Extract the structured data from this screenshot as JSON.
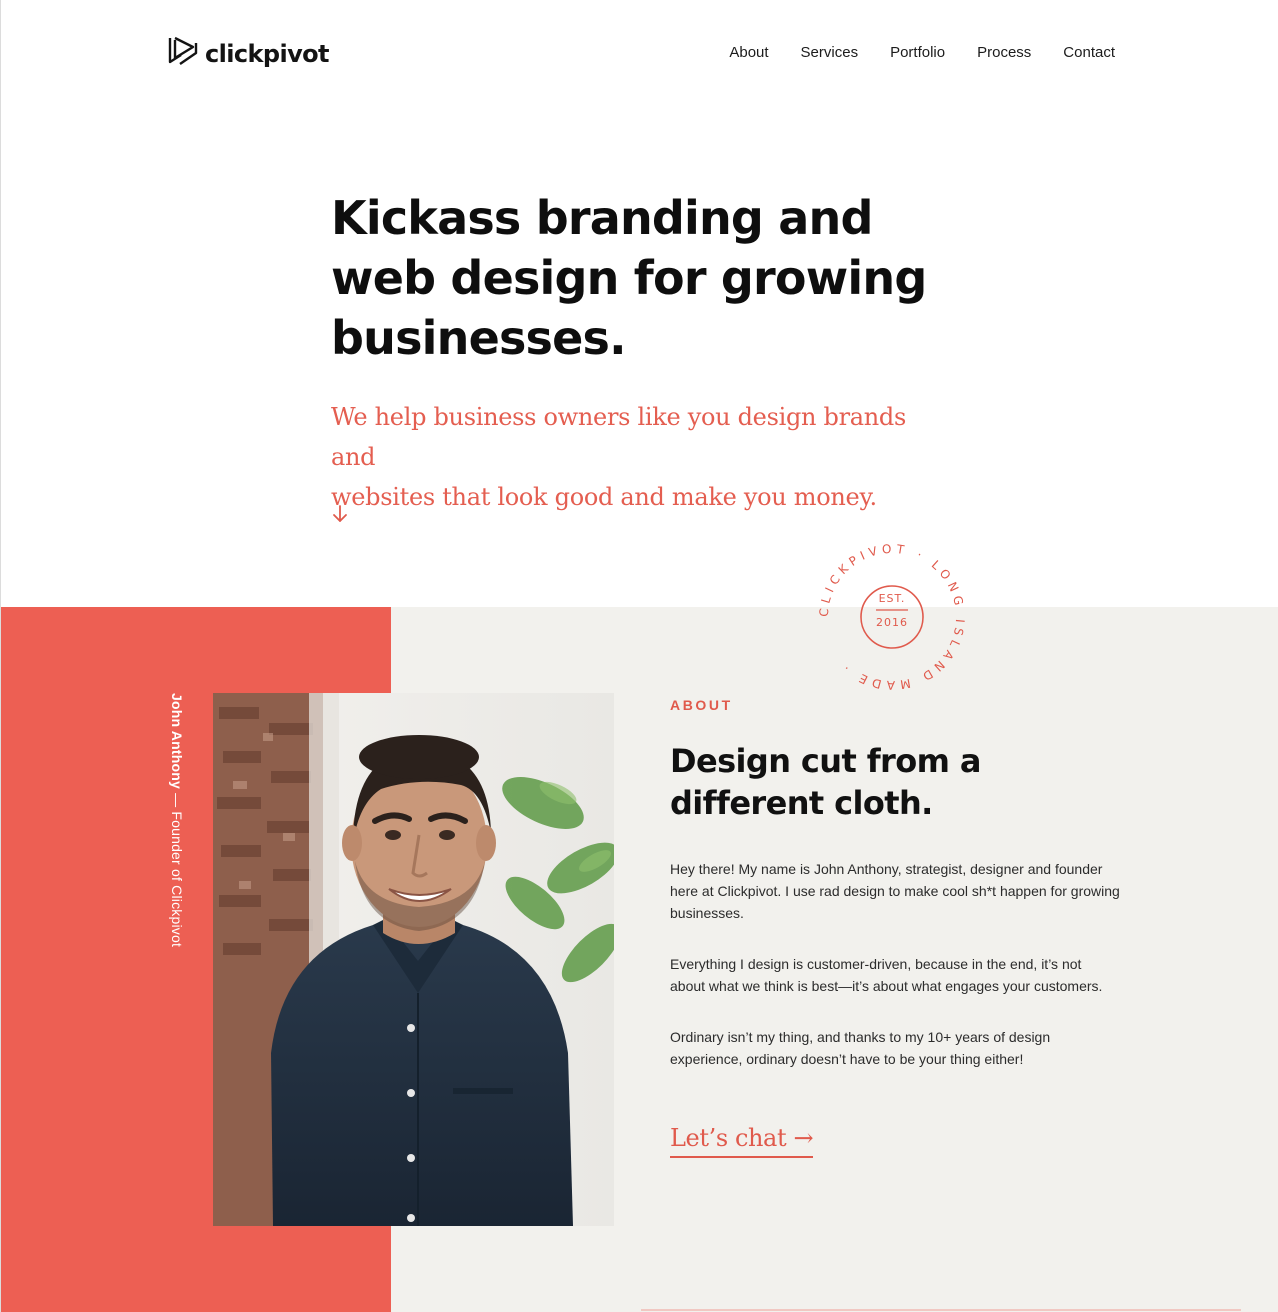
{
  "header": {
    "logo_text": "clickpivot",
    "nav": [
      "About",
      "Services",
      "Portfolio",
      "Process",
      "Contact"
    ]
  },
  "hero": {
    "title_lines": [
      "Kickass branding and",
      "web design for growing",
      "businesses."
    ],
    "subtitle_lines": [
      "We help business owners like you design brands and",
      "websites that look good and make you money."
    ],
    "arrow_icon": "arrow-down-icon"
  },
  "badge": {
    "ring_text": "CLICKPIVOT · LONG ISLAND MADE ·",
    "est": "EST.",
    "year": "2016"
  },
  "about": {
    "caption_name": "John Anthony",
    "caption_role": " — Founder of Clickpivot",
    "eyebrow": "ABOUT",
    "title_lines": [
      "Design cut from a",
      "different cloth."
    ],
    "paragraphs": [
      "Hey there! My name is John Anthony, strategist, designer and founder here at Clickpivot. I use rad design to make cool sh*t happen for growing businesses.",
      "Everything I design is customer-driven, because in the end, it’s not about what we think is best—it’s about what engages your customers.",
      "Ordinary isn’t my thing, and thanks to my 10+ years of design experience, ordinary doesn’t have to be your thing either!"
    ],
    "cta": "Let’s chat →"
  },
  "colors": {
    "accent": "#ed5f53",
    "accent_text": "#e05a4c",
    "section_bg": "#f2f1ed"
  }
}
